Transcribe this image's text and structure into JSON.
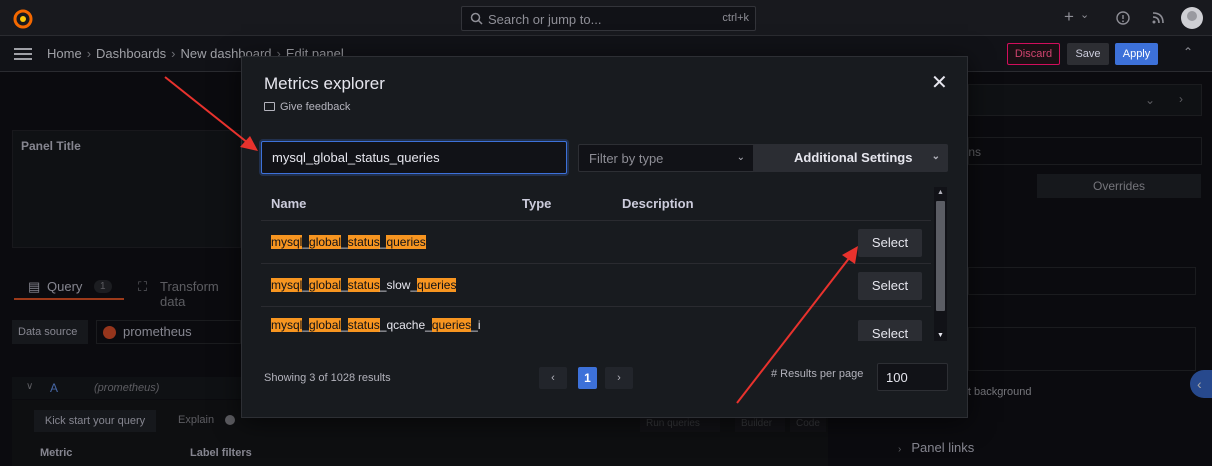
{
  "topbar": {
    "search_placeholder": "Search or jump to...",
    "search_shortcut": "ctrl+k",
    "plus_label": "+",
    "plus_chevron": "⌄"
  },
  "navbar": {
    "breadcrumbs": [
      "Home",
      "Dashboards",
      "New dashboard",
      "Edit panel"
    ],
    "discard_label": "Discard",
    "save_label": "Save",
    "apply_label": "Apply"
  },
  "editor": {
    "panel_title": "Panel Title",
    "tabs": [
      {
        "label": "Query",
        "count": "1"
      },
      {
        "label": "Transform data"
      }
    ],
    "datasource_label": "Data source",
    "datasource_value": "prometheus",
    "query_ref": "A",
    "query_ds": "(prometheus)",
    "kick_start": "Kick start your query",
    "explain": "Explain",
    "metric_label": "Metric",
    "label_filters_label": "Label filters",
    "ghost_buttons": [
      "Run queries",
      "Builder",
      "Code"
    ]
  },
  "options_pane": {
    "search_placeholder": "Search options",
    "tab_overrides": "Overrides",
    "background_label": "Transparent background",
    "panel_links": "Panel links"
  },
  "modal": {
    "title": "Metrics explorer",
    "feedback": "Give feedback",
    "search_value": "mysql_global_status_queries",
    "filter_placeholder": "Filter by type",
    "additional_settings": "Additional Settings",
    "columns": [
      "Name",
      "Type",
      "Description"
    ],
    "rows": [
      {
        "segments": [
          {
            "t": "mysql",
            "h": true
          },
          {
            "t": "_",
            "h": false
          },
          {
            "t": "global",
            "h": true
          },
          {
            "t": "_",
            "h": false
          },
          {
            "t": "status",
            "h": true
          },
          {
            "t": "_",
            "h": false
          },
          {
            "t": "queries",
            "h": true
          }
        ],
        "type": "",
        "description": ""
      },
      {
        "segments": [
          {
            "t": "mysql",
            "h": true
          },
          {
            "t": "_",
            "h": false
          },
          {
            "t": "global",
            "h": true
          },
          {
            "t": "_",
            "h": false
          },
          {
            "t": "status",
            "h": true
          },
          {
            "t": "_slow_",
            "h": false
          },
          {
            "t": "queries",
            "h": true
          }
        ],
        "type": "",
        "description": ""
      },
      {
        "segments": [
          {
            "t": "mysql",
            "h": true
          },
          {
            "t": "_",
            "h": false
          },
          {
            "t": "global",
            "h": true
          },
          {
            "t": "_",
            "h": false
          },
          {
            "t": "status",
            "h": true
          },
          {
            "t": "_qcache_",
            "h": false
          },
          {
            "t": "queries",
            "h": true
          },
          {
            "t": "_i",
            "h": false
          }
        ],
        "type": "",
        "description": ""
      }
    ],
    "select_label": "Select",
    "showing": "Showing 3 of 1028 results",
    "current_page": "1",
    "results_per_page_label": "# Results per page",
    "results_per_page": "100"
  },
  "colors": {
    "accent": "#3d71d9",
    "highlight": "#f79520",
    "annotation": "#e8322d",
    "discard": "#d10e5c"
  }
}
